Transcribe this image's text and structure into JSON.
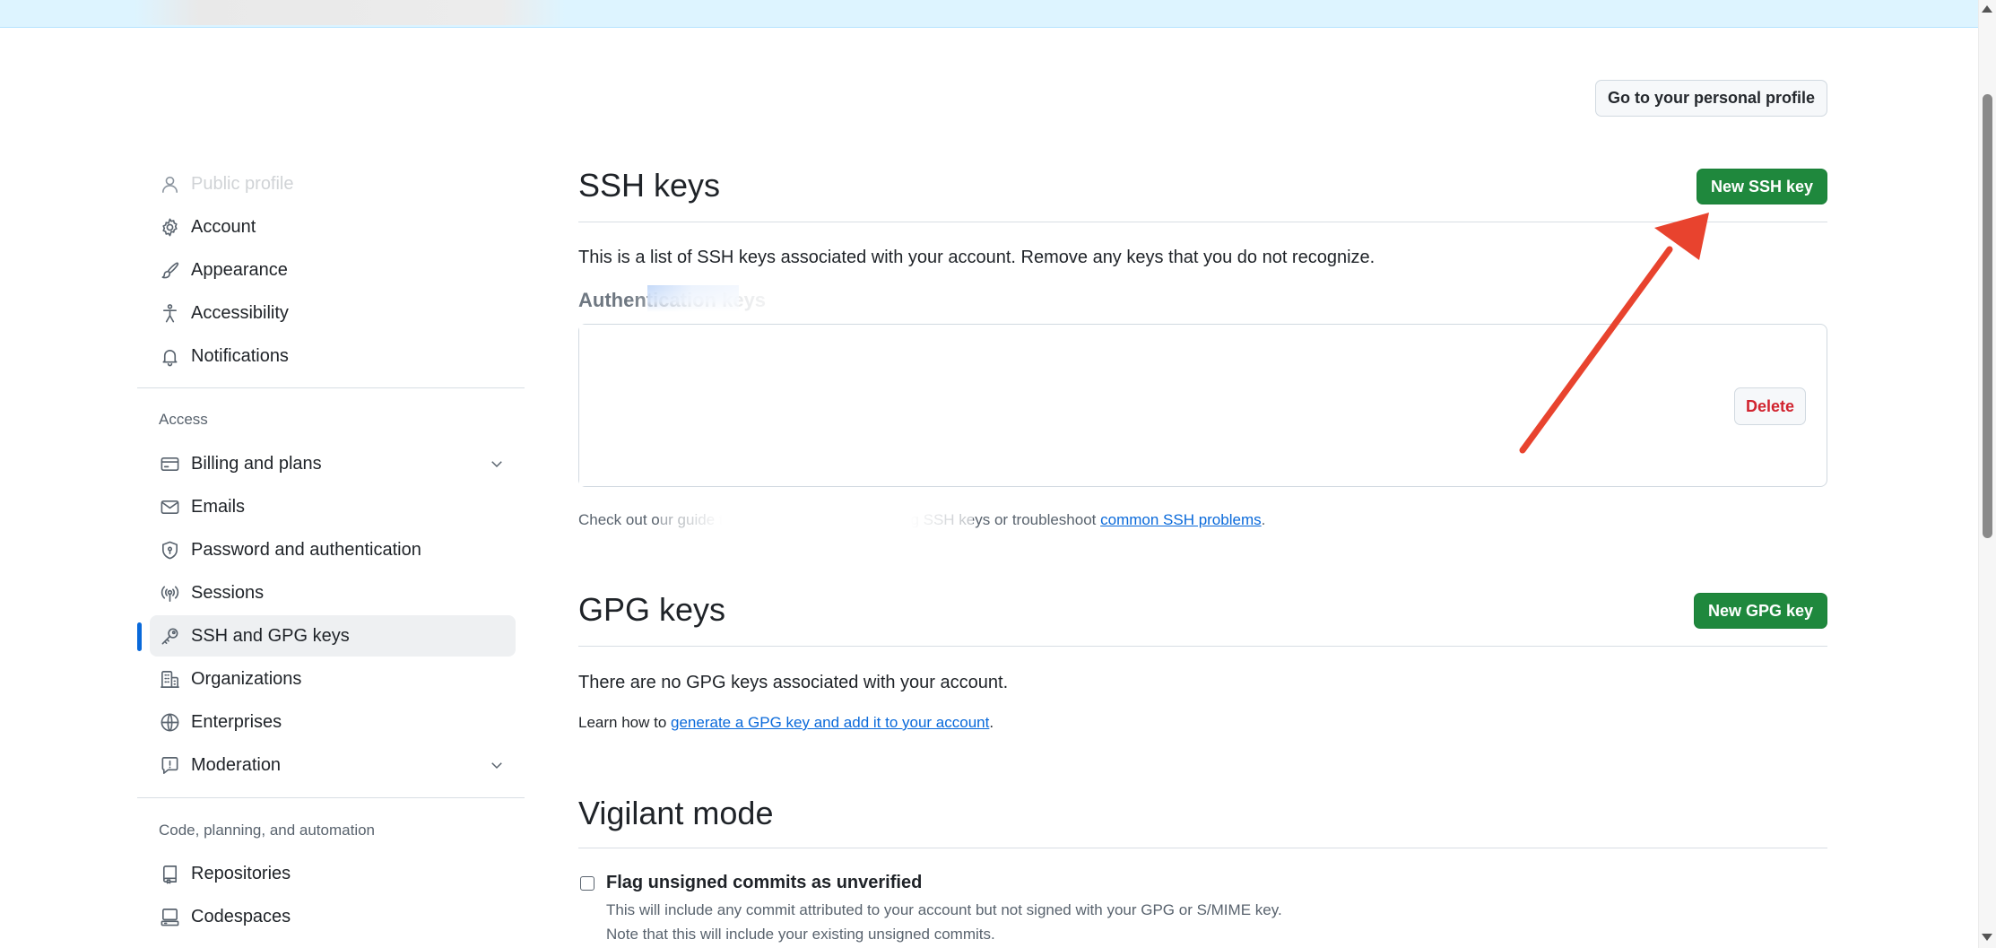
{
  "colors": {
    "accent": "#0969da",
    "primary_button": "#1f883d",
    "danger_text": "#d1242f",
    "annotation_arrow": "#e8432e"
  },
  "header": {
    "profile_button": "Go to your personal profile"
  },
  "sidebar": {
    "top_items": [
      {
        "label": "Public profile",
        "icon": "person-icon"
      },
      {
        "label": "Account",
        "icon": "gear-icon"
      },
      {
        "label": "Appearance",
        "icon": "paintbrush-icon"
      },
      {
        "label": "Accessibility",
        "icon": "accessibility-icon"
      },
      {
        "label": "Notifications",
        "icon": "bell-icon"
      }
    ],
    "access_heading": "Access",
    "access_items": [
      {
        "label": "Billing and plans",
        "icon": "credit-card-icon",
        "expandable": true
      },
      {
        "label": "Emails",
        "icon": "mail-icon"
      },
      {
        "label": "Password and authentication",
        "icon": "shield-lock-icon"
      },
      {
        "label": "Sessions",
        "icon": "broadcast-icon"
      },
      {
        "label": "SSH and GPG keys",
        "icon": "key-icon",
        "active": true
      },
      {
        "label": "Organizations",
        "icon": "organization-icon"
      },
      {
        "label": "Enterprises",
        "icon": "globe-icon"
      },
      {
        "label": "Moderation",
        "icon": "report-icon",
        "expandable": true
      }
    ],
    "code_heading": "Code, planning, and automation",
    "code_items": [
      {
        "label": "Repositories",
        "icon": "repo-icon"
      },
      {
        "label": "Codespaces",
        "icon": "codespaces-icon"
      }
    ]
  },
  "ssh": {
    "title": "SSH keys",
    "new_button": "New SSH key",
    "description": "This is a list of SSH keys associated with your account. Remove any keys that you do not recognize.",
    "auth_heading": "Authentication keys",
    "delete_button": "Delete",
    "footer_prefix": "Check out our guide to connecting to GitHub using SSH keys or troubleshoot ",
    "footer_link": "common SSH problems",
    "footer_suffix": "."
  },
  "gpg": {
    "title": "GPG keys",
    "new_button": "New GPG key",
    "empty_text": "There are no GPG keys associated with your account.",
    "learn_prefix": "Learn how to ",
    "learn_link": "generate a GPG key and add it to your account",
    "learn_suffix": "."
  },
  "vigilant": {
    "title": "Vigilant mode",
    "checkbox_label": "Flag unsigned commits as unverified",
    "checkbox_checked": false,
    "note_line1": "This will include any commit attributed to your account but not signed with your GPG or S/MIME key.",
    "note_line2": "Note that this will include your existing unsigned commits."
  }
}
